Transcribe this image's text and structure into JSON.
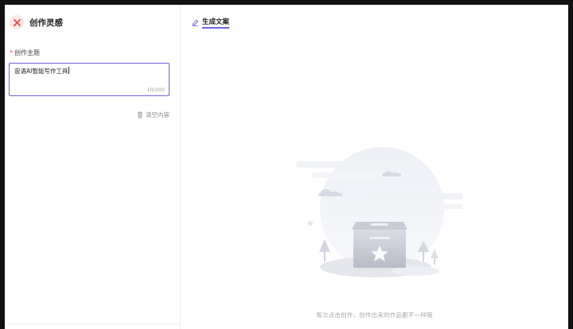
{
  "sidebar": {
    "title": "创作灵感",
    "logo_icon": "close-x-icon",
    "field_label": "创作主题",
    "required_mark": "*",
    "input_value": "宙语AI智能写作工具",
    "counter": "10/200",
    "clear_label": "清空内容"
  },
  "main": {
    "tab_label": "生成文案",
    "empty_message": "每次点击创作，创作出来的作品都不一样哦"
  },
  "colors": {
    "accent": "#6e62e0",
    "required": "#e34d4d",
    "logo_bg": "#fde7e7",
    "logo_fg": "#e34d4d"
  }
}
